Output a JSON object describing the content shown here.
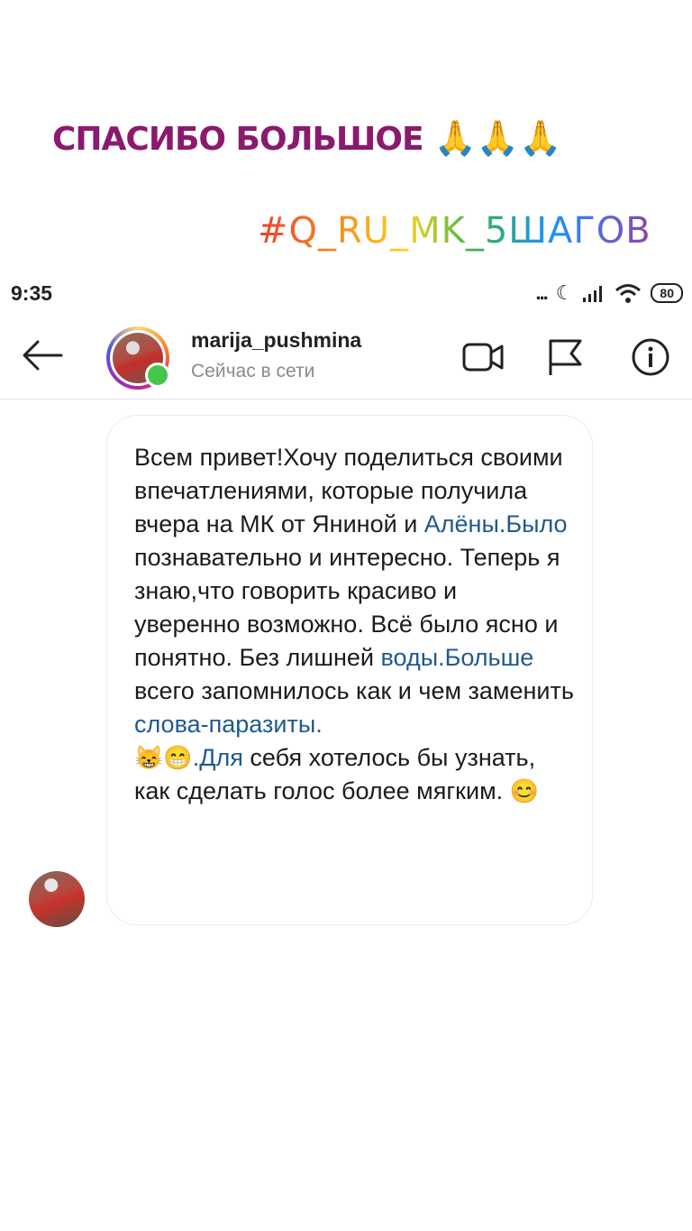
{
  "overlay": {
    "thanks_text": "СПАСИБО БОЛЬШОЕ",
    "pray_emoji": "🙏🙏🙏",
    "hashtag": "#Q_RU_MK_5ШАГОВ"
  },
  "status_bar": {
    "time": "9:35",
    "dots": "...",
    "battery": "80"
  },
  "header": {
    "username": "marija_pushmina",
    "presence": "Сейчас в сети"
  },
  "message": {
    "part1": "Всем привет!Хочу поделиться своими впечатлениями, которые получила вчера на МК от Яниной и ",
    "link1": "Алёны.Было",
    "part2": " познавательно и интересно. Теперь я знаю,что говорить красиво и  уверенно возможно. Всё было ясно и понятно. Без лишней ",
    "link2": "воды.Больше",
    "part3": " всего запомнилось как и чем заменить ",
    "link3": "слова-паразиты.",
    "emoji1": "😸😁",
    "link4": ".Для",
    "part4": " себя хотелось бы узнать, как сделать голос более мягким. ",
    "emoji2": "😊"
  },
  "icons": {
    "back": "arrow-left-icon",
    "video": "video-call-icon",
    "flag": "flag-icon",
    "info": "info-icon"
  },
  "colors": {
    "thanks": "#8a1a6e",
    "link": "#1f5a8f",
    "online": "#44c74b"
  }
}
